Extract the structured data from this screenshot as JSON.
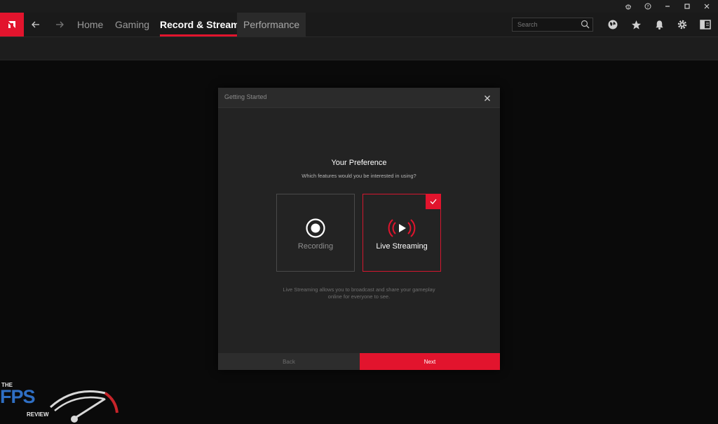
{
  "window": {
    "controls": [
      "bug-icon",
      "help-icon",
      "minimize-icon",
      "maximize-icon",
      "close-icon"
    ]
  },
  "nav": {
    "tabs": [
      {
        "label": "Home",
        "state": "normal"
      },
      {
        "label": "Gaming",
        "state": "normal"
      },
      {
        "label": "Record & Stream",
        "state": "active"
      },
      {
        "label": "Performance",
        "state": "hover"
      }
    ],
    "search": {
      "placeholder": "Search",
      "value": ""
    },
    "icons": [
      "globe-icon",
      "star-icon",
      "bell-icon",
      "gear-icon",
      "sidebar-panel-icon"
    ]
  },
  "modal": {
    "title": "Getting Started",
    "heading": "Your Preference",
    "subheading": "Which features would you be interested in using?",
    "options": [
      {
        "label": "Recording",
        "icon": "record-icon",
        "selected": false
      },
      {
        "label": "Live Streaming",
        "icon": "live-stream-icon",
        "selected": true
      }
    ],
    "description": "Live Streaming allows you to broadcast and share your gameplay online for everyone to see.",
    "back_label": "Back",
    "next_label": "Next"
  },
  "watermark": {
    "the": "THE",
    "fps": "FPS",
    "review": "REVIEW"
  },
  "colors": {
    "accent": "#e2142d",
    "background": "#0a0a0a",
    "panel": "#232323"
  }
}
